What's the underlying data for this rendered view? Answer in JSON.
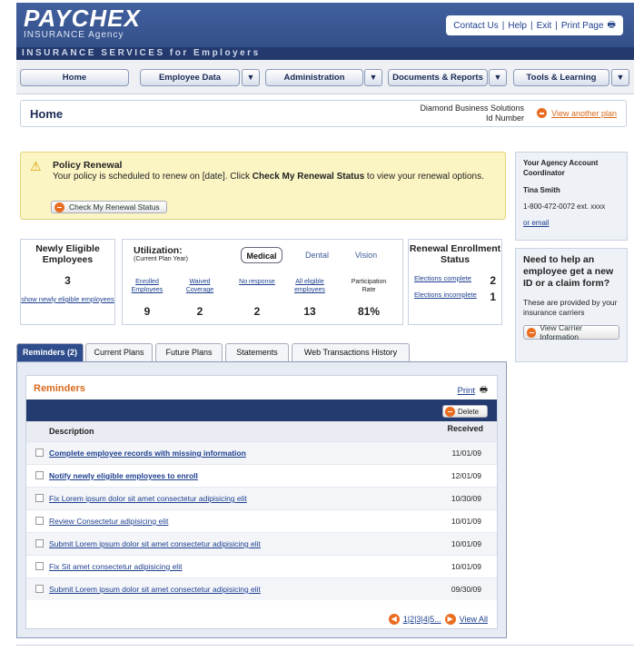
{
  "header": {
    "logo_main": "PAYCHEX",
    "logo_sub": "INSURANCE Agency",
    "links": [
      "Contact Us",
      "Help",
      "Exit",
      "Print Page"
    ],
    "tagline": "INSURANCE SERVICES for Employers"
  },
  "nav": [
    "Home",
    "Employee Data",
    "Administration",
    "Documents & Reports",
    "Tools & Learning"
  ],
  "homebar": {
    "title": "Home",
    "company": "Diamond Business Solutions",
    "id_label": "Id Number",
    "view_link": "View another plan"
  },
  "policy": {
    "title": "Policy Renewal",
    "text_pre": "Your policy is scheduled to renew on [date]. Click ",
    "text_bold": "Check My Renewal Status",
    "text_post": " to view your renewal options.",
    "button": "Check My Renewal Status"
  },
  "newly_eligible": {
    "title": "Newly Eligible Employees",
    "count": "3",
    "link": "show newly eligible employees"
  },
  "utilization": {
    "title": "Utilization:",
    "subtitle": "(Current Plan Year)",
    "tabs": [
      "Medical",
      "Dental",
      "Vision"
    ],
    "columns": [
      {
        "label": "Enrolled Employees",
        "value": "9"
      },
      {
        "label": "Waived Coverage",
        "value": "2"
      },
      {
        "label": "No response",
        "value": "2"
      },
      {
        "label": "All eligible employees",
        "value": "13"
      },
      {
        "label": "Participation Rate",
        "value": "81%"
      }
    ]
  },
  "renewal": {
    "title": "Renewal Enrollment Status",
    "rows": [
      {
        "label": "Elections complete",
        "value": "2"
      },
      {
        "label": "Elections incomplete",
        "value": "1"
      }
    ]
  },
  "coordinator": {
    "title": "Your Agency Account Coordinator",
    "name": "Tina Smith",
    "phone": "1-800-472-0072 ext. xxxx",
    "email": "or email"
  },
  "help": {
    "question": "Need to help an employee get a new ID or a claim form?",
    "text": "These are provided by your insurance carriers",
    "button": "View Carrier Information"
  },
  "tabs": [
    "Reminders (2)",
    "Current Plans",
    "Future Plans",
    "Statements",
    "Web Transactions History"
  ],
  "reminders": {
    "title": "Reminders",
    "print": "Print",
    "delete": "Delete",
    "col_description": "Description",
    "col_received": "Received",
    "rows": [
      {
        "text": "Complete employee records with missing information",
        "date": "11/01/09"
      },
      {
        "text": "Notify newly eligible employees to enroll",
        "date": "12/01/09"
      },
      {
        "text": "Fix Lorem ipsum dolor sit amet consectetur adipisicing elit",
        "date": "10/30/09"
      },
      {
        "text": "Review Consectetur adipisicing elit",
        "date": "10/01/09"
      },
      {
        "text": "Submit Lorem ipsum dolor sit amet consectetur adipisicing elit",
        "date": "10/01/09"
      },
      {
        "text": "Fix Sit amet consectetur adipisicing elit",
        "date": "10/01/09"
      },
      {
        "text": "Submit Lorem ipsum dolor sit amet consectetur adipisicing elit",
        "date": "09/30/09"
      }
    ],
    "pager_pages": "1|2|3|4|5...",
    "view_all": "View All"
  }
}
